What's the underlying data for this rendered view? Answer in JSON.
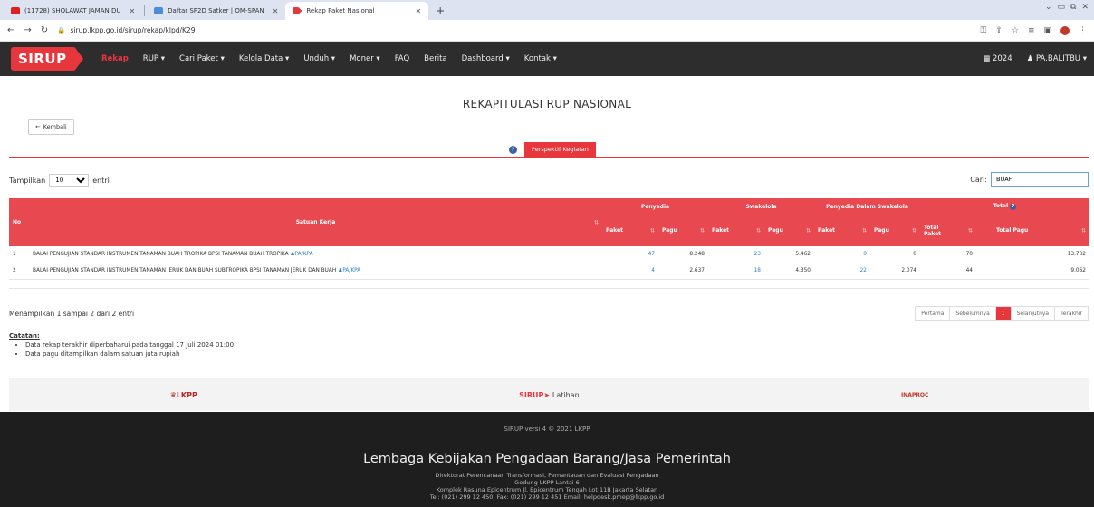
{
  "browser": {
    "tabs": [
      {
        "title": "(11728) SHOLAWAT JAMAN DU",
        "color": "#e02020"
      },
      {
        "title": "Daftar SP2D Satker | OM-SPAN",
        "color": "#4a8cd8"
      },
      {
        "title": "Rekap Paket Nasional",
        "color": "#e8363d"
      }
    ],
    "new_tab": "+",
    "url": "sirup.lkpp.go.id/sirup/rekap/klpd/K29"
  },
  "navbar": {
    "logo_text": "SIRUP",
    "items": [
      "Rekap",
      "RUP ▾",
      "Cari Paket ▾",
      "Kelola Data ▾",
      "Unduh ▾",
      "Moner ▾",
      "FAQ",
      "Berita",
      "Dashboard ▾",
      "Kontak ▾"
    ],
    "year": "2024",
    "user": "PA.BALITBU ▾"
  },
  "page": {
    "title": "REKAPITULASI RUP NASIONAL",
    "back_label": "Kembali",
    "perspective_label": "Perspektif Kegiatan"
  },
  "controls": {
    "show_label": "Tampilkan",
    "page_size": "10",
    "entries_label": "entri",
    "search_label": "Cari:",
    "search_value": "BUAH"
  },
  "table": {
    "h_no": "No",
    "h_satker": "Satuan Kerja",
    "h_penyedia": "Penyedia",
    "h_swakelola": "Swakelola",
    "h_pds": "Penyedia Dalam Swakelola",
    "h_total": "Total",
    "h_paket": "Paket",
    "h_pagu": "Pagu",
    "h_total_paket": "Total Paket",
    "h_total_pagu": "Total Pagu",
    "rows": [
      {
        "no": "1",
        "satker": "BALAI PENGUJIAN STANDAR INSTRUMEN TANAMAN BUAH TROPIKA BPSI TANAMAN BUAH TROPIKA",
        "role": "PA/KPA",
        "penyedia_paket": "47",
        "penyedia_pagu": "8.248",
        "swakelola_paket": "23",
        "swakelola_pagu": "5.462",
        "pds_paket": "0",
        "pds_pagu": "0",
        "total_paket": "70",
        "total_pagu": "13.702"
      },
      {
        "no": "2",
        "satker": "BALAI PENGUJIAN STANDAR INSTRUMEN TANAMAN JERUK DAN BUAH SUBTROPIKA BPSI TANAMAN JERUK DAN BUAH",
        "role": "PA/KPA",
        "penyedia_paket": "4",
        "penyedia_pagu": "2.637",
        "swakelola_paket": "18",
        "swakelola_pagu": "4.350",
        "pds_paket": "22",
        "pds_pagu": "2.074",
        "total_paket": "44",
        "total_pagu": "9.062"
      }
    ]
  },
  "pagination": {
    "info": "Menampilkan 1 sampai 2 dari 2 entri",
    "first": "Pertama",
    "prev": "Sebelumnya",
    "current": "1",
    "next": "Selanjutnya",
    "last": "Terakhir"
  },
  "notes": {
    "title": "Catatan:",
    "items": [
      "Data rekap terakhir diperbaharui pada tanggal 17 Juli 2024 01:00",
      "Data pagu ditampilkan dalam satuan juta rupiah"
    ]
  },
  "sponsors": {
    "lkpp": "LKPP",
    "sirup": "SIRUP",
    "sirup_suffix": "Latihan",
    "inaproc": "INAPROC"
  },
  "footer": {
    "version": "SIRUP versi 4 © 2021 LKPP",
    "org": "Lembaga Kebijakan Pengadaan Barang/Jasa Pemerintah",
    "line1": "Direktorat Perencanaan Transformasi, Pemantauan dan Evaluasi Pengadaan",
    "line2": "Gedung LKPP Lantai 6",
    "line3": "Komplek Rasuna Epicentrum Jl. Epicentrum Tengah Lot 11B Jakarta Selatan",
    "line4": "Tel: (021) 299 12 450, Fax: (021) 299 12 451 Email: helpdesk.pmep@lkpp.go.id"
  },
  "colors": {
    "accent": "#e8363d",
    "header_bg": "#e8484f",
    "navbar_bg": "#2d2d2d",
    "link": "#2a7ec3"
  }
}
